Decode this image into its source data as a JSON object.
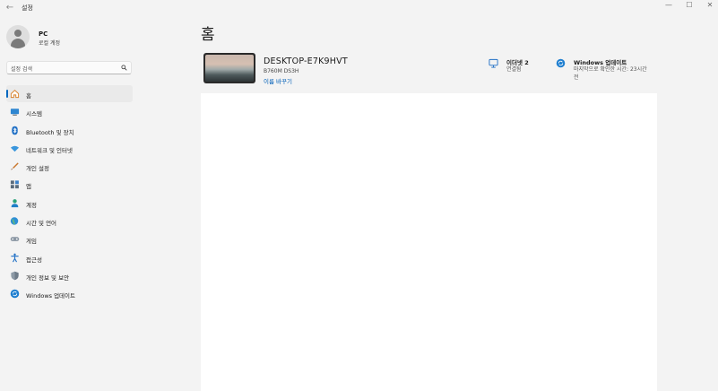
{
  "titlebar": {
    "back_glyph": "←",
    "title": "설정",
    "minimize_glyph": "—",
    "maximize_glyph": "☐",
    "close_glyph": "✕"
  },
  "profile": {
    "name": "PC",
    "account_type": "로컬 계정"
  },
  "search": {
    "placeholder": "설정 검색"
  },
  "nav": {
    "items": [
      {
        "label": "홈",
        "icon": "home-icon",
        "active": true
      },
      {
        "label": "시스템",
        "icon": "monitor-icon"
      },
      {
        "label": "Bluetooth 및 장치",
        "icon": "bluetooth-icon"
      },
      {
        "label": "네트워크 및 인터넷",
        "icon": "wifi-icon"
      },
      {
        "label": "개인 설정",
        "icon": "brush-icon"
      },
      {
        "label": "앱",
        "icon": "apps-icon"
      },
      {
        "label": "계정",
        "icon": "person-icon"
      },
      {
        "label": "시간 및 언어",
        "icon": "globe-clock-icon"
      },
      {
        "label": "게임",
        "icon": "gamepad-icon"
      },
      {
        "label": "접근성",
        "icon": "accessibility-icon"
      },
      {
        "label": "개인 정보 및 보안",
        "icon": "shield-icon"
      },
      {
        "label": "Windows 업데이트",
        "icon": "update-icon"
      }
    ]
  },
  "main": {
    "title": "홈",
    "device": {
      "name": "DESKTOP-E7K9HVT",
      "model": "B760M DS3H",
      "rename_label": "이름 바꾸기"
    },
    "ethernet": {
      "title": "이더넷 2",
      "status": "연결됨"
    },
    "windows_update": {
      "title": "Windows 업데이트",
      "status_line1": "마지막으로 확인한 시간: 23시간",
      "status_line2": "전"
    }
  },
  "colors": {
    "accent": "#0067c0",
    "link": "#005fb8",
    "background": "#f3f3f3",
    "panel": "#ffffff"
  }
}
